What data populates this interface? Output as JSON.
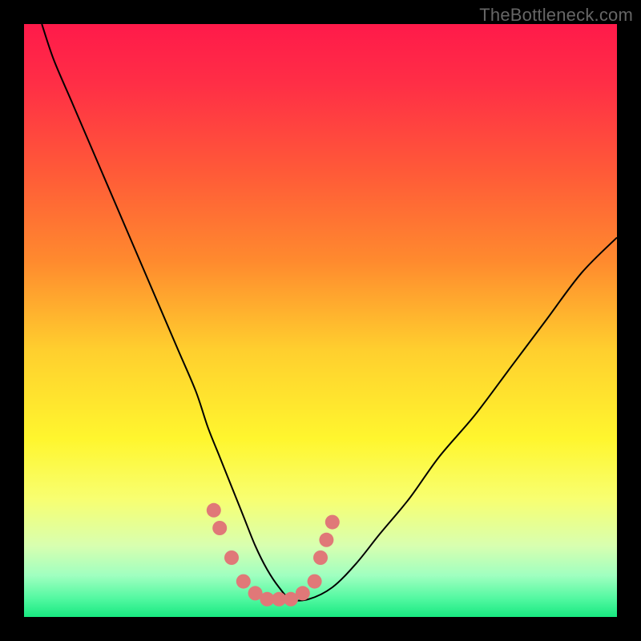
{
  "watermark": "TheBottleneck.com",
  "chart_data": {
    "type": "line",
    "title": "",
    "xlabel": "",
    "ylabel": "",
    "xlim": [
      0,
      100
    ],
    "ylim": [
      0,
      100
    ],
    "background": {
      "type": "vertical-gradient",
      "stops": [
        {
          "offset": 0.0,
          "color": "#ff1a4a"
        },
        {
          "offset": 0.1,
          "color": "#ff2e46"
        },
        {
          "offset": 0.25,
          "color": "#ff5a38"
        },
        {
          "offset": 0.4,
          "color": "#ff8a2e"
        },
        {
          "offset": 0.55,
          "color": "#ffcf2e"
        },
        {
          "offset": 0.7,
          "color": "#fff62e"
        },
        {
          "offset": 0.8,
          "color": "#f8ff70"
        },
        {
          "offset": 0.88,
          "color": "#d8ffb0"
        },
        {
          "offset": 0.93,
          "color": "#a0ffc0"
        },
        {
          "offset": 0.97,
          "color": "#50f8a0"
        },
        {
          "offset": 1.0,
          "color": "#18e880"
        }
      ]
    },
    "series": [
      {
        "name": "bottleneck-curve",
        "color": "#000000",
        "width": 2,
        "x": [
          3,
          5,
          8,
          11,
          14,
          17,
          20,
          23,
          26,
          29,
          31,
          33,
          35,
          37,
          39,
          41,
          43,
          45,
          48,
          52,
          56,
          60,
          65,
          70,
          76,
          82,
          88,
          94,
          100
        ],
        "y": [
          100,
          94,
          87,
          80,
          73,
          66,
          59,
          52,
          45,
          38,
          32,
          27,
          22,
          17,
          12,
          8,
          5,
          3,
          3,
          5,
          9,
          14,
          20,
          27,
          34,
          42,
          50,
          58,
          64
        ]
      }
    ],
    "highlight": {
      "name": "optimal-zone-markers",
      "marker_color": "#e07878",
      "marker_radius": 9,
      "points": [
        {
          "x": 32,
          "y": 18
        },
        {
          "x": 33,
          "y": 15
        },
        {
          "x": 35,
          "y": 10
        },
        {
          "x": 37,
          "y": 6
        },
        {
          "x": 39,
          "y": 4
        },
        {
          "x": 41,
          "y": 3
        },
        {
          "x": 43,
          "y": 3
        },
        {
          "x": 45,
          "y": 3
        },
        {
          "x": 47,
          "y": 4
        },
        {
          "x": 49,
          "y": 6
        },
        {
          "x": 50,
          "y": 10
        },
        {
          "x": 51,
          "y": 13
        },
        {
          "x": 52,
          "y": 16
        }
      ]
    }
  }
}
